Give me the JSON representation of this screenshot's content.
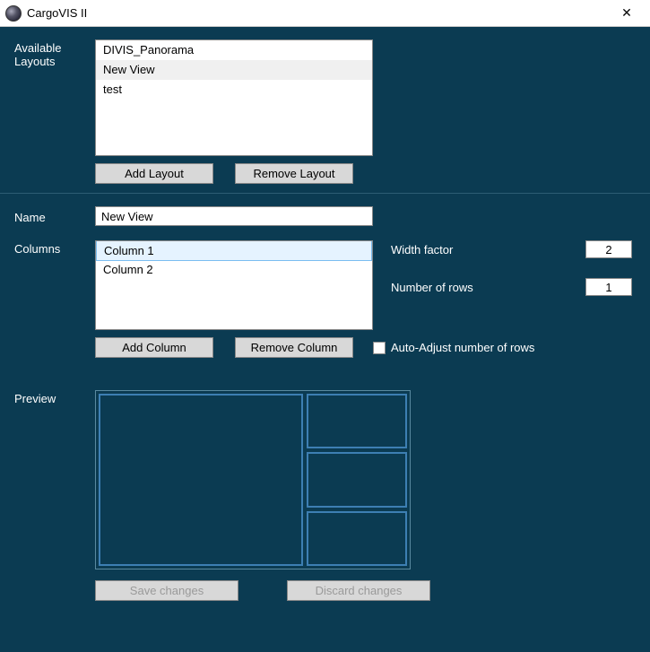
{
  "window": {
    "title": "CargoVIS II"
  },
  "labels": {
    "available_layouts": "Available Layouts",
    "name": "Name",
    "columns": "Columns",
    "width_factor": "Width factor",
    "number_of_rows": "Number of rows",
    "auto_adjust": "Auto-Adjust number of rows",
    "preview": "Preview"
  },
  "layouts": {
    "items": [
      "DIVIS_Panorama",
      "New View",
      "test"
    ],
    "selected_index": 1
  },
  "buttons": {
    "add_layout": "Add Layout",
    "remove_layout": "Remove Layout",
    "add_column": "Add Column",
    "remove_column": "Remove Column",
    "save_changes": "Save changes",
    "discard_changes": "Discard changes"
  },
  "form": {
    "name_value": "New View",
    "columns": [
      "Column 1",
      "Column 2"
    ],
    "selected_column_index": 0,
    "width_factor": "2",
    "number_of_rows": "1",
    "auto_adjust_checked": false
  }
}
